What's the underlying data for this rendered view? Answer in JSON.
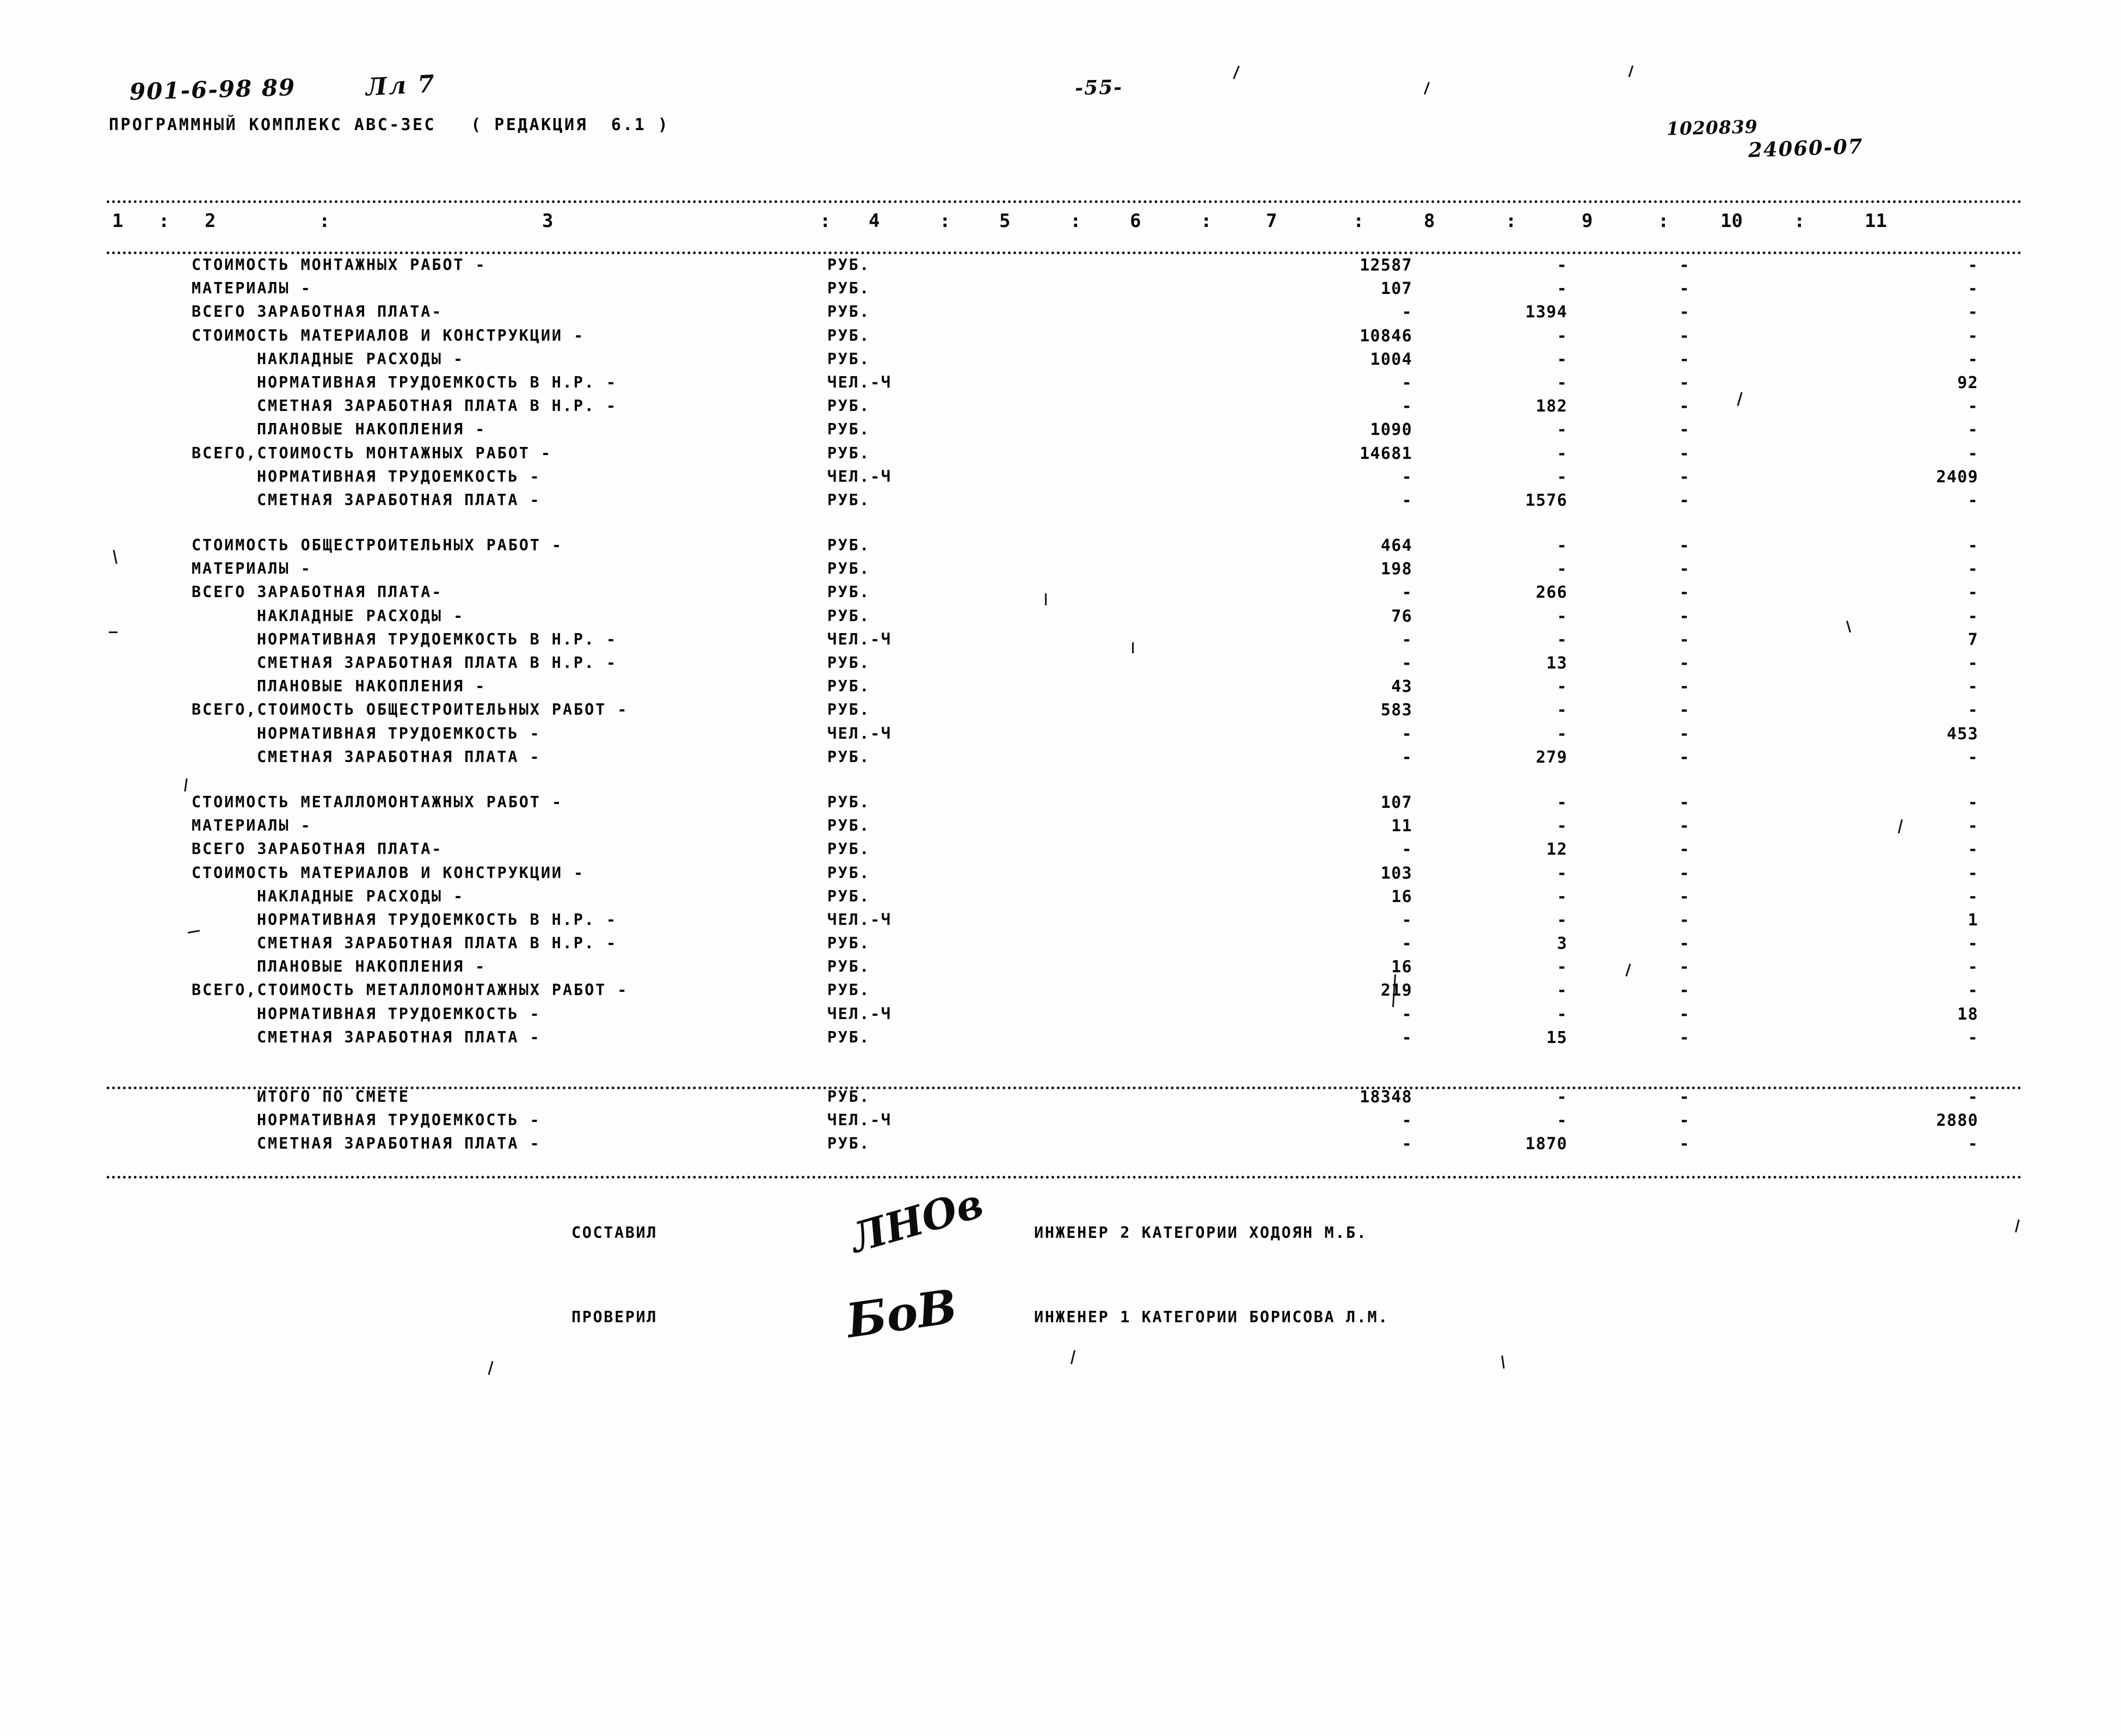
{
  "header": {
    "hand_code": "901-6-98 89",
    "hand_sheet": "Лл 7",
    "program_line": "ПРОГРАММНЫЙ КОМПЛЕКС АВС-ЗЕС   ( РЕДАКЦИЯ  6.1 )",
    "page_number": "-55-",
    "doc_number_1": "1020839",
    "doc_number_2": "24060-07"
  },
  "table": {
    "column_numbers": [
      "1",
      "2",
      "3",
      "4",
      "5",
      "6",
      "7",
      "8",
      "9",
      "10",
      "11"
    ],
    "separator": ":",
    "units": {
      "rub": "РУБ.",
      "chel_ch": "ЧЕЛ.-Ч"
    },
    "empty": "-",
    "blocks": [
      {
        "name": "montazhnye-raboty",
        "rows": [
          {
            "label": "СТОИМОСТЬ МОНТАЖНЫХ РАБОТ -",
            "indent": 0,
            "unit": "РУБ.",
            "c7": "12587",
            "c8": "-",
            "c9": "-",
            "c10": "",
            "c11": "-"
          },
          {
            "label": "МАТЕРИАЛЫ -",
            "indent": 0,
            "unit": "РУБ.",
            "c7": "107",
            "c8": "-",
            "c9": "-",
            "c10": "",
            "c11": "-"
          },
          {
            "label": "ВСЕГО ЗАРАБОТНАЯ ПЛАТА-",
            "indent": 0,
            "unit": "РУБ.",
            "c7": "-",
            "c8": "1394",
            "c9": "-",
            "c10": "",
            "c11": "-"
          },
          {
            "label": "СТОИМОСТЬ МАТЕРИАЛОВ И КОНСТРУКЦИИ -",
            "indent": 0,
            "unit": "РУБ.",
            "c7": "10846",
            "c8": "-",
            "c9": "-",
            "c10": "",
            "c11": "-"
          },
          {
            "label": "НАКЛАДНЫЕ РАСХОДЫ -",
            "indent": 1,
            "unit": "РУБ.",
            "c7": "1004",
            "c8": "-",
            "c9": "-",
            "c10": "",
            "c11": "-"
          },
          {
            "label": "НОРМАТИВНАЯ ТРУДОЕМКОСТЬ В Н.Р. -",
            "indent": 1,
            "unit": "ЧЕЛ.-Ч",
            "c7": "-",
            "c8": "-",
            "c9": "-",
            "c10": "",
            "c11": "92"
          },
          {
            "label": "СМЕТНАЯ ЗАРАБОТНАЯ ПЛАТА В Н.Р. -",
            "indent": 1,
            "unit": "РУБ.",
            "c7": "-",
            "c8": "182",
            "c9": "-",
            "c10": "",
            "c11": "-"
          },
          {
            "label": "ПЛАНОВЫЕ НАКОПЛЕНИЯ -",
            "indent": 1,
            "unit": "РУБ.",
            "c7": "1090",
            "c8": "-",
            "c9": "-",
            "c10": "",
            "c11": "-"
          },
          {
            "label": "ВСЕГО,СТОИМОСТЬ МОНТАЖНЫХ РАБОТ -",
            "indent": 0,
            "unit": "РУБ.",
            "c7": "14681",
            "c8": "-",
            "c9": "-",
            "c10": "",
            "c11": "-"
          },
          {
            "label": "НОРМАТИВНАЯ ТРУДОЕМКОСТЬ -",
            "indent": 1,
            "unit": "ЧЕЛ.-Ч",
            "c7": "-",
            "c8": "-",
            "c9": "-",
            "c10": "",
            "c11": "2409"
          },
          {
            "label": "СМЕТНАЯ ЗАРАБОТНАЯ ПЛАТА -",
            "indent": 1,
            "unit": "РУБ.",
            "c7": "-",
            "c8": "1576",
            "c9": "-",
            "c10": "",
            "c11": "-"
          }
        ]
      },
      {
        "name": "obshchestroitelnye-raboty",
        "rows": [
          {
            "label": "СТОИМОСТЬ ОБЩЕСТРОИТЕЛЬНЫХ РАБОТ -",
            "indent": 0,
            "unit": "РУБ.",
            "c7": "464",
            "c8": "-",
            "c9": "-",
            "c10": "",
            "c11": "-"
          },
          {
            "label": "МАТЕРИАЛЫ -",
            "indent": 0,
            "unit": "РУБ.",
            "c7": "198",
            "c8": "-",
            "c9": "-",
            "c10": "",
            "c11": "-"
          },
          {
            "label": "ВСЕГО ЗАРАБОТНАЯ ПЛАТА-",
            "indent": 0,
            "unit": "РУБ.",
            "c7": "-",
            "c8": "266",
            "c9": "-",
            "c10": "",
            "c11": "-"
          },
          {
            "label": "НАКЛАДНЫЕ РАСХОДЫ -",
            "indent": 1,
            "unit": "РУБ.",
            "c7": "76",
            "c8": "-",
            "c9": "-",
            "c10": "",
            "c11": "-"
          },
          {
            "label": "НОРМАТИВНАЯ ТРУДОЕМКОСТЬ В Н.Р. -",
            "indent": 1,
            "unit": "ЧЕЛ.-Ч",
            "c7": "-",
            "c8": "-",
            "c9": "-",
            "c10": "",
            "c11": "7"
          },
          {
            "label": "СМЕТНАЯ ЗАРАБОТНАЯ ПЛАТА В Н.Р. -",
            "indent": 1,
            "unit": "РУБ.",
            "c7": "-",
            "c8": "13",
            "c9": "-",
            "c10": "",
            "c11": "-"
          },
          {
            "label": "ПЛАНОВЫЕ НАКОПЛЕНИЯ -",
            "indent": 1,
            "unit": "РУБ.",
            "c7": "43",
            "c8": "-",
            "c9": "-",
            "c10": "",
            "c11": "-"
          },
          {
            "label": "ВСЕГО,СТОИМОСТЬ ОБЩЕСТРОИТЕЛЬНЫХ РАБОТ -",
            "indent": 0,
            "unit": "РУБ.",
            "c7": "583",
            "c8": "-",
            "c9": "-",
            "c10": "",
            "c11": "-"
          },
          {
            "label": "НОРМАТИВНАЯ ТРУДОЕМКОСТЬ -",
            "indent": 1,
            "unit": "ЧЕЛ.-Ч",
            "c7": "-",
            "c8": "-",
            "c9": "-",
            "c10": "",
            "c11": "453"
          },
          {
            "label": "СМЕТНАЯ ЗАРАБОТНАЯ ПЛАТА -",
            "indent": 1,
            "unit": "РУБ.",
            "c7": "-",
            "c8": "279",
            "c9": "-",
            "c10": "",
            "c11": "-"
          }
        ]
      },
      {
        "name": "metallomontazhnye-raboty",
        "rows": [
          {
            "label": "СТОИМОСТЬ МЕТАЛЛОМОНТАЖНЫХ РАБОТ -",
            "indent": 0,
            "unit": "РУБ.",
            "c7": "107",
            "c8": "-",
            "c9": "-",
            "c10": "",
            "c11": "-"
          },
          {
            "label": "МАТЕРИАЛЫ -",
            "indent": 0,
            "unit": "РУБ.",
            "c7": "11",
            "c8": "-",
            "c9": "-",
            "c10": "",
            "c11": "-"
          },
          {
            "label": "ВСЕГО ЗАРАБОТНАЯ ПЛАТА-",
            "indent": 0,
            "unit": "РУБ.",
            "c7": "-",
            "c8": "12",
            "c9": "-",
            "c10": "",
            "c11": "-"
          },
          {
            "label": "СТОИМОСТЬ МАТЕРИАЛОВ И КОНСТРУКЦИИ -",
            "indent": 0,
            "unit": "РУБ.",
            "c7": "103",
            "c8": "-",
            "c9": "-",
            "c10": "",
            "c11": "-"
          },
          {
            "label": "НАКЛАДНЫЕ РАСХОДЫ -",
            "indent": 1,
            "unit": "РУБ.",
            "c7": "16",
            "c8": "-",
            "c9": "-",
            "c10": "",
            "c11": "-"
          },
          {
            "label": "НОРМАТИВНАЯ ТРУДОЕМКОСТЬ В Н.Р. -",
            "indent": 1,
            "unit": "ЧЕЛ.-Ч",
            "c7": "-",
            "c8": "-",
            "c9": "-",
            "c10": "",
            "c11": "1"
          },
          {
            "label": "СМЕТНАЯ ЗАРАБОТНАЯ ПЛАТА В Н.Р. -",
            "indent": 1,
            "unit": "РУБ.",
            "c7": "-",
            "c8": "3",
            "c9": "-",
            "c10": "",
            "c11": "-"
          },
          {
            "label": "ПЛАНОВЫЕ НАКОПЛЕНИЯ -",
            "indent": 1,
            "unit": "РУБ.",
            "c7": "16",
            "c8": "-",
            "c9": "-",
            "c10": "",
            "c11": "-"
          },
          {
            "label": "ВСЕГО,СТОИМОСТЬ МЕТАЛЛОМОНТАЖНЫХ РАБОТ -",
            "indent": 0,
            "unit": "РУБ.",
            "c7": "219",
            "c8": "-",
            "c9": "-",
            "c10": "",
            "c11": "-"
          },
          {
            "label": "НОРМАТИВНАЯ ТРУДОЕМКОСТЬ -",
            "indent": 1,
            "unit": "ЧЕЛ.-Ч",
            "c7": "-",
            "c8": "-",
            "c9": "-",
            "c10": "",
            "c11": "18"
          },
          {
            "label": "СМЕТНАЯ ЗАРАБОТНАЯ ПЛАТА -",
            "indent": 1,
            "unit": "РУБ.",
            "c7": "-",
            "c8": "15",
            "c9": "-",
            "c10": "",
            "c11": "-"
          }
        ]
      },
      {
        "name": "itogo-po-smete",
        "rows": [
          {
            "label": "ИТОГО ПО СМЕТЕ",
            "indent": 1,
            "unit": "РУБ.",
            "c7": "18348",
            "c8": "-",
            "c9": "-",
            "c10": "",
            "c11": "-"
          },
          {
            "label": "НОРМАТИВНАЯ ТРУДОЕМКОСТЬ -",
            "indent": 1,
            "unit": "ЧЕЛ.-Ч",
            "c7": "-",
            "c8": "-",
            "c9": "-",
            "c10": "",
            "c11": "2880"
          },
          {
            "label": "СМЕТНАЯ ЗАРАБОТНАЯ ПЛАТА -",
            "indent": 1,
            "unit": "РУБ.",
            "c7": "-",
            "c8": "1870",
            "c9": "-",
            "c10": "",
            "c11": "-"
          }
        ]
      }
    ]
  },
  "signatures": [
    {
      "action": "СОСТАВИЛ",
      "mark": "ЛНОв",
      "person": "ИНЖЕНЕР 2 КАТЕГОРИИ ХОДОЯН М.Б."
    },
    {
      "action": "ПРОВЕРИЛ",
      "mark": "БoВ",
      "person": "ИНЖЕНЕР 1 КАТЕГОРИИ БОРИСОВА Л.М."
    }
  ]
}
